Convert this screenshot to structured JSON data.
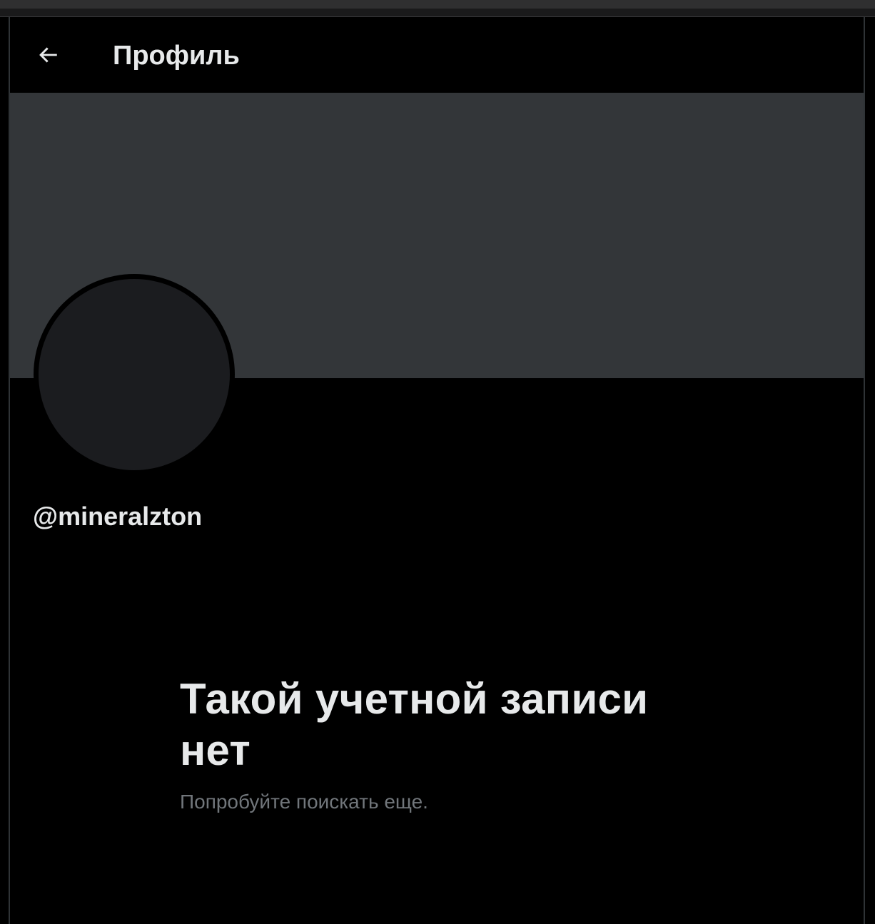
{
  "window": {
    "title": ""
  },
  "header": {
    "back_icon": "arrow-left-icon",
    "title": "Профиль"
  },
  "profile": {
    "handle": "@mineralzton",
    "banner_color": "#333639",
    "avatar_color": "#1b1c1f"
  },
  "empty_state": {
    "title": "Такой учетной записи нет",
    "subtitle": "Попробуйте поискать еще."
  },
  "colors": {
    "background": "#000000",
    "primary_text": "#e7e9ea",
    "secondary_text": "#71767b"
  }
}
